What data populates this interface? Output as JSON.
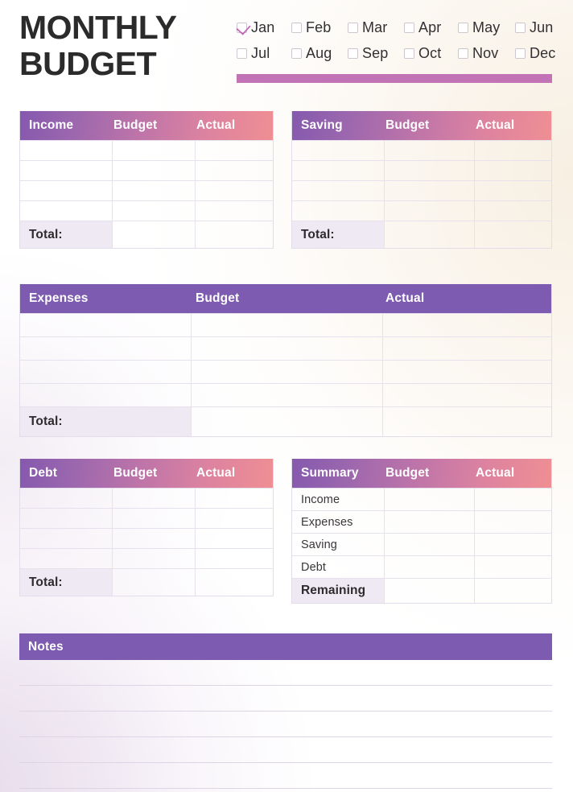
{
  "header": {
    "title_line1": "MONTHLY",
    "title_line2": "BUDGET",
    "divider_color": "#c173b5"
  },
  "months": {
    "row1": [
      {
        "label": "Jan",
        "checked": true
      },
      {
        "label": "Feb",
        "checked": false
      },
      {
        "label": "Mar",
        "checked": false
      },
      {
        "label": "Apr",
        "checked": false
      },
      {
        "label": "May",
        "checked": false
      },
      {
        "label": "Jun",
        "checked": false
      }
    ],
    "row2": [
      {
        "label": "Jul",
        "checked": false
      },
      {
        "label": "Aug",
        "checked": false
      },
      {
        "label": "Sep",
        "checked": false
      },
      {
        "label": "Oct",
        "checked": false
      },
      {
        "label": "Nov",
        "checked": false
      },
      {
        "label": "Dec",
        "checked": false
      }
    ]
  },
  "tables": {
    "income": {
      "headers": [
        "Income",
        "Budget",
        "Actual"
      ],
      "entry_rows": 4,
      "total_label": "Total:",
      "header_style": "gradient"
    },
    "saving": {
      "headers": [
        "Saving",
        "Budget",
        "Actual"
      ],
      "entry_rows": 4,
      "total_label": "Total:",
      "header_style": "gradient"
    },
    "expenses": {
      "headers": [
        "Expenses",
        "Budget",
        "Actual"
      ],
      "entry_rows": 4,
      "total_label": "Total:",
      "header_style": "solid-purple"
    },
    "debt": {
      "headers": [
        "Debt",
        "Budget",
        "Actual"
      ],
      "entry_rows": 4,
      "total_label": "Total:",
      "header_style": "gradient"
    },
    "summary": {
      "headers": [
        "Summary",
        "Budget",
        "Actual"
      ],
      "rows": [
        "Income",
        "Expenses",
        "Saving",
        "Debt"
      ],
      "remaining_label": "Remaining",
      "header_style": "gradient"
    }
  },
  "notes": {
    "title": "Notes",
    "line_count": 5
  },
  "colors": {
    "gradient_start": "#8559ae",
    "gradient_end": "#ef8e93",
    "solid_purple": "#7d5bb0",
    "total_row_bg": "#eee9f3",
    "checkmark": "#c062b4",
    "grid_line": "#e7e1ee",
    "title_text": "#2b2b2b"
  }
}
